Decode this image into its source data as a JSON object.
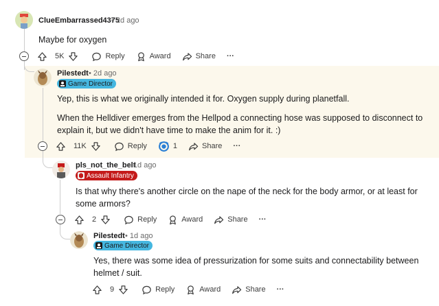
{
  "colors": {
    "highlight_bg": "#fcf8ec",
    "game_director_flair": "#45b7e0",
    "assault_infantry_flair": "#c41a1a",
    "thread_line": "#cccccc",
    "meta_text": "#6a6a6a"
  },
  "comments": [
    {
      "username": "ClueEmbarrassed4375",
      "time": "• 2d ago",
      "body": [
        "Maybe for oxygen"
      ],
      "votes": "5K",
      "actions": {
        "reply": "Reply",
        "award": "Award",
        "share": "Share",
        "more": "···"
      }
    },
    {
      "username": "Pilestedt",
      "time": "• 2d ago",
      "flair": "Game Director",
      "body": [
        "Yep, this is what we originally intended it for. Oxygen supply during planetfall.",
        "When the Helldiver emerges from the Hellpod a connecting hose was supposed to disconnect to explain it, but we didn't have time to make the anim for it. :)"
      ],
      "votes": "11K",
      "actions": {
        "reply": "Reply",
        "award_count": "1",
        "share": "Share",
        "more": "···"
      }
    },
    {
      "username": "pls_not_the_belt",
      "time": "• 1d ago",
      "flair": "Assault Infantry",
      "body": [
        "Is that why there's another circle on the nape of the neck for the body armor, or at least for some armors?"
      ],
      "votes": "2",
      "actions": {
        "reply": "Reply",
        "award": "Award",
        "share": "Share",
        "more": "···"
      }
    },
    {
      "username": "Pilestedt",
      "time": "• 1d ago",
      "flair": "Game Director",
      "body": [
        "Yes, there was some idea of pressurization for some suits and connectability between helmet / suit."
      ],
      "votes": "9",
      "actions": {
        "reply": "Reply",
        "award": "Award",
        "share": "Share",
        "more": "···"
      }
    }
  ]
}
